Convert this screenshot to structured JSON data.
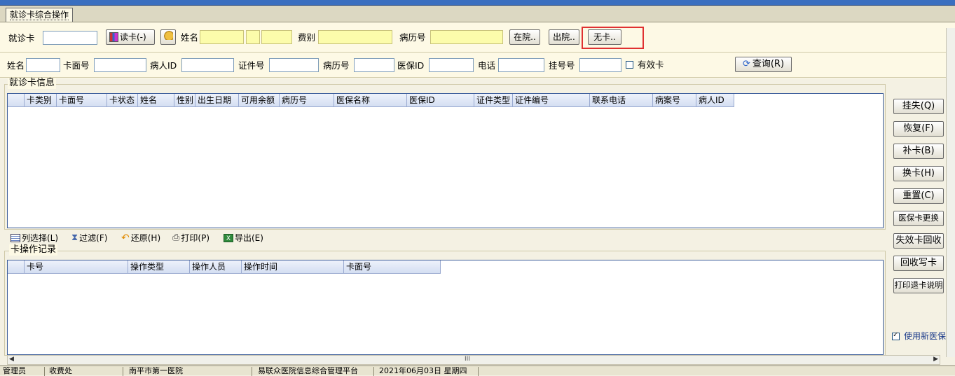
{
  "tab": {
    "label": "就诊卡综合操作"
  },
  "row1": {
    "card_label": "就诊卡",
    "card_value": "",
    "read_card_button": "读卡(-)",
    "name_label": "姓名",
    "fee_label": "费别",
    "record_label": "病历号",
    "in_hospital_button": "在院..",
    "out_hospital_button": "出院..",
    "no_card_button": "无卡.."
  },
  "row2": {
    "name_label": "姓名",
    "card_face_label": "卡面号",
    "patient_id_label": "病人ID",
    "cert_label": "证件号",
    "record_label": "病历号",
    "insurance_id_label": "医保ID",
    "phone_label": "电话",
    "reg_label": "挂号号",
    "valid_card_label": "有效卡",
    "query_button": "查询(R)"
  },
  "card_info": {
    "title": "就诊卡信息",
    "columns": [
      "卡类别",
      "卡面号",
      "卡状态",
      "姓名",
      "性别",
      "出生日期",
      "可用余额",
      "病历号",
      "医保名称",
      "医保ID",
      "证件类型",
      "证件编号",
      "联系电话",
      "病案号",
      "病人ID"
    ]
  },
  "toolbar": {
    "column_select": "列选择(L)",
    "filter": "过滤(F)",
    "restore": "还原(H)",
    "print": "打印(P)",
    "export": "导出(E)"
  },
  "card_ops": {
    "title": "卡操作记录",
    "columns": [
      "卡号",
      "操作类型",
      "操作人员",
      "操作时间",
      "卡面号"
    ]
  },
  "side_buttons": {
    "report_loss": "挂失(Q)",
    "recover": "恢复(F)",
    "reissue": "补卡(B)",
    "replace": "换卡(H)",
    "reset": "重置(C)",
    "insurance_change": "医保卡更换",
    "invalid_recycle": "失效卡回收",
    "recycle_write": "回收写卡",
    "print_refund": "打印退卡说明"
  },
  "use_new_insurance": "使用新医保",
  "status": {
    "user": "管理员",
    "dept": "收费处",
    "hospital": "南平市第一医院",
    "platform": "易联众医院信息综合管理平台",
    "date": "2021年06月03日  星期四"
  },
  "scroll": {
    "grip": "III"
  }
}
